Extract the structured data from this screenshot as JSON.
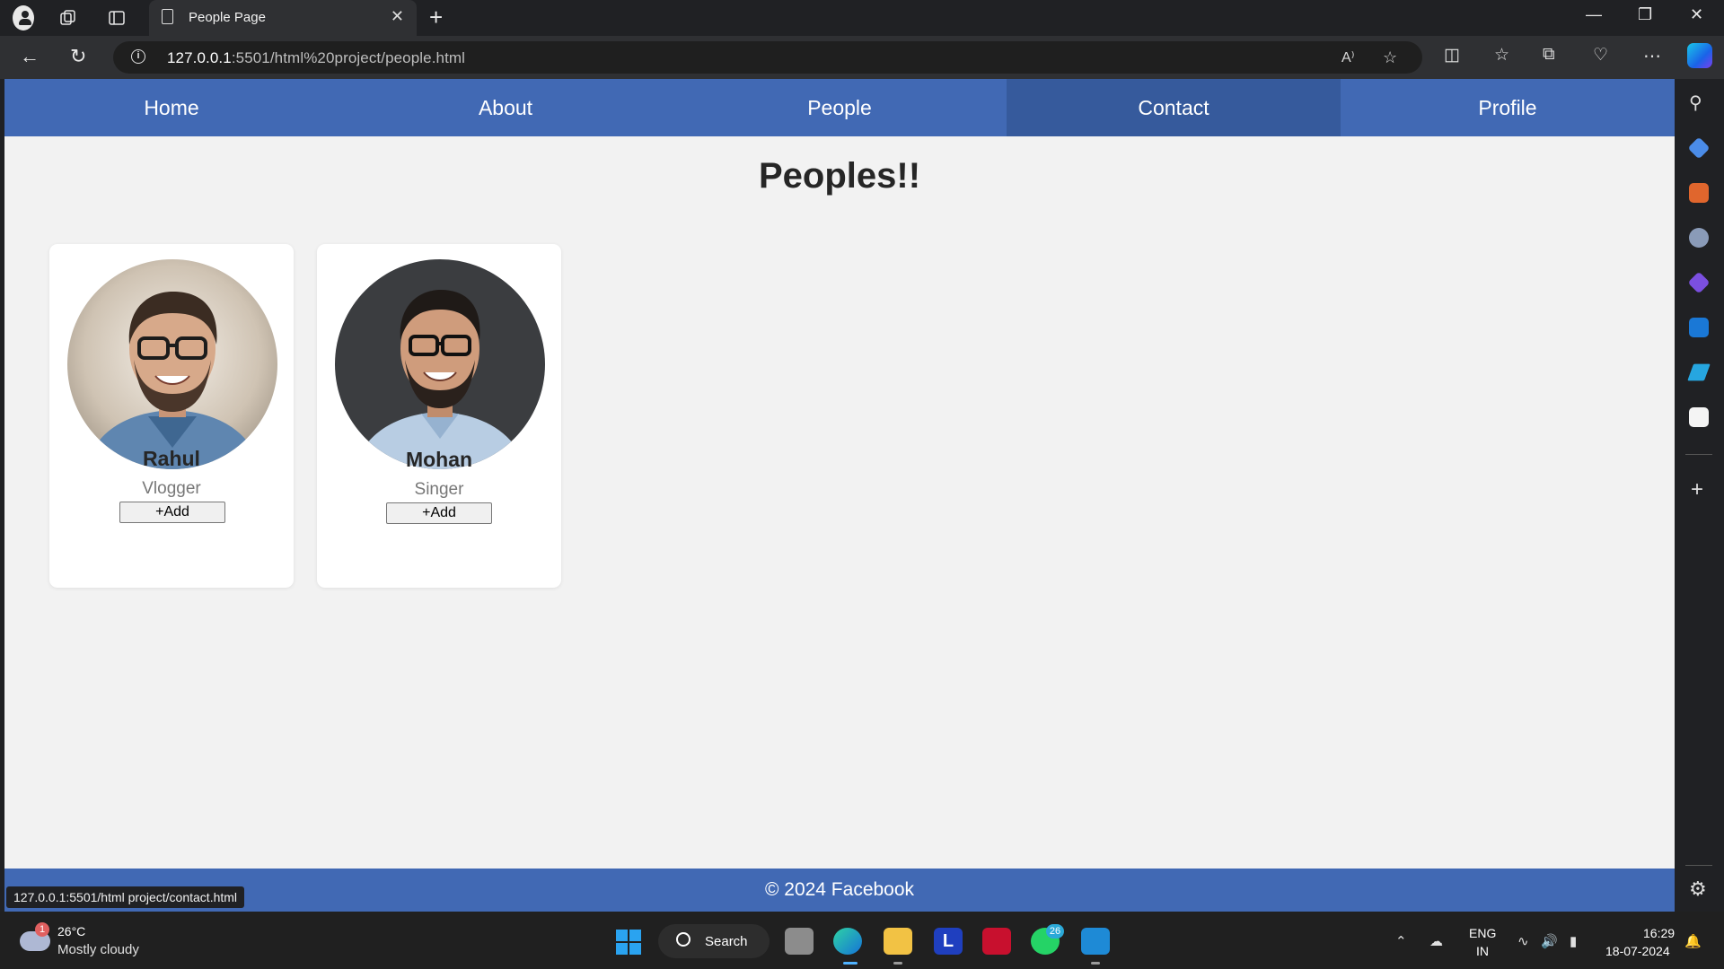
{
  "browser": {
    "tab_title": "People Page",
    "tab_close": "✕",
    "new_tab": "+",
    "url_host": "127.0.0.1",
    "url_rest": ":5501/html%20project/people.html",
    "status_url": "127.0.0.1:5501/html project/contact.html",
    "read_aloud": "A⁾"
  },
  "site": {
    "nav": [
      {
        "label": "Home"
      },
      {
        "label": "About"
      },
      {
        "label": "People"
      },
      {
        "label": "Contact",
        "hovered": true
      },
      {
        "label": "Profile"
      }
    ],
    "heading": "Peoples!!",
    "people": [
      {
        "name": "Rahul",
        "role": "Vlogger",
        "button": "+Add"
      },
      {
        "name": "Mohan",
        "role": "Singer",
        "button": "+Add"
      }
    ],
    "footer": "© 2024 Facebook"
  },
  "taskbar": {
    "weather_badge": "1",
    "temperature": "26°C",
    "weather": "Mostly cloudy",
    "search_label": "Search",
    "whatsapp_badge": "26",
    "lang_line1": "ENG",
    "lang_line2": "IN",
    "time": "16:29",
    "date": "18-07-2024"
  },
  "colors": {
    "nav_bg": "#4169b4",
    "nav_hover": "#365a9c",
    "page_bg": "#f2f2f2"
  }
}
